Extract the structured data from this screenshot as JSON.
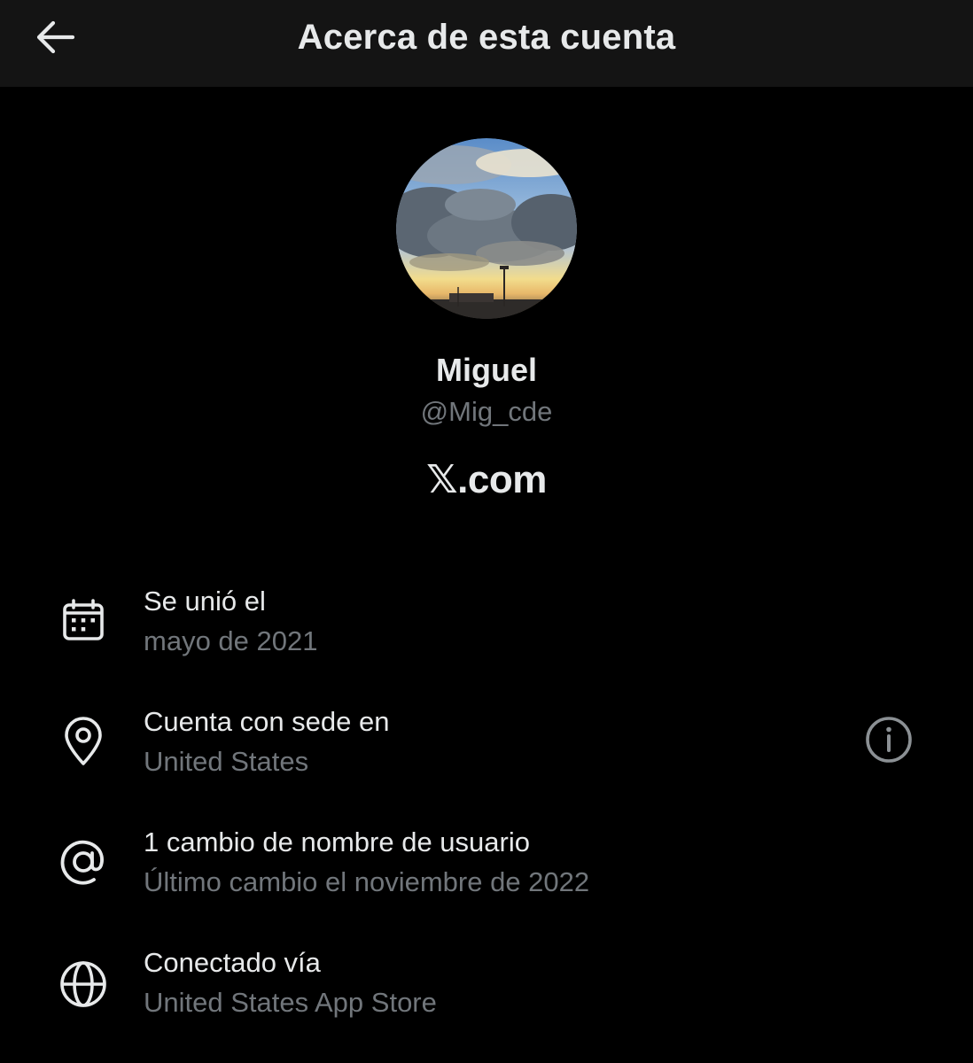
{
  "header": {
    "title": "Acerca de esta cuenta",
    "back_icon": "arrow-left-icon"
  },
  "profile": {
    "name": "Miguel",
    "handle": "@Mig_cde",
    "site": "𝕏.com"
  },
  "details": [
    {
      "icon": "calendar-icon",
      "title": "Se unió el",
      "subtitle": "mayo de 2021"
    },
    {
      "icon": "location-pin-icon",
      "title": "Cuenta con sede en",
      "subtitle": "United States",
      "trailing_icon": "info-icon"
    },
    {
      "icon": "at-sign-icon",
      "title": "1 cambio de nombre de usuario",
      "subtitle": "Último cambio el noviembre de 2022"
    },
    {
      "icon": "globe-icon",
      "title": "Conectado vía",
      "subtitle": "United States App Store"
    }
  ],
  "colors": {
    "background": "#000000",
    "header_background": "#141414",
    "primary_text": "#e7e9ea",
    "secondary_text": "#71767b"
  }
}
